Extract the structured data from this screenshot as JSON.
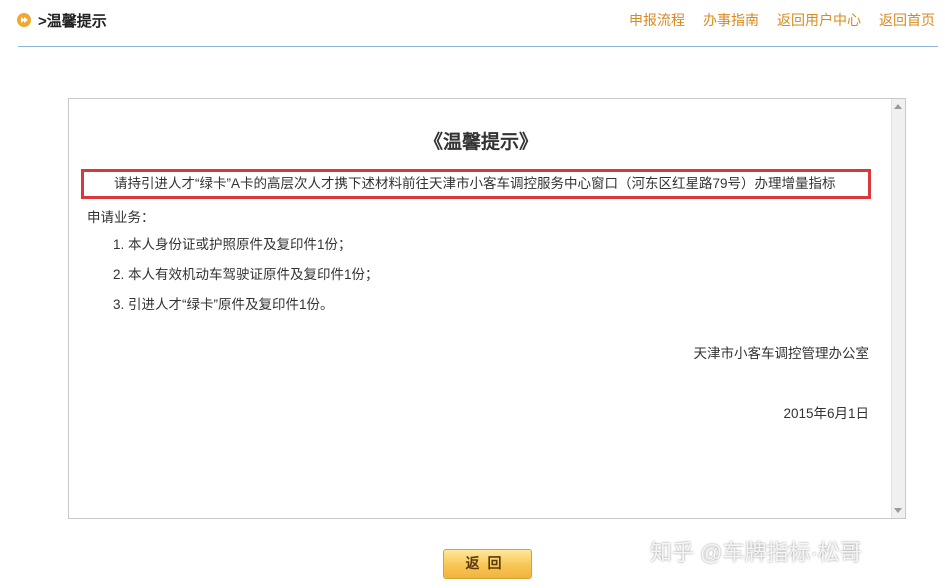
{
  "header": {
    "title": ">温馨提示",
    "nav": [
      "申报流程",
      "办事指南",
      "返回用户中心",
      "返回首页"
    ]
  },
  "notice": {
    "title": "《温馨提示》",
    "para1": "请持引进人才“绿卡”A卡的高层次人才携下述材料前往天津市小客车调控服务中心窗口（河东区红星路79号）办理增量指标",
    "para2": "申请业务：",
    "items": [
      "1. 本人身份证或护照原件及复印件1份；",
      "2. 本人有效机动车驾驶证原件及复印件1份；",
      "3. 引进人才“绿卡”原件及复印件1份。"
    ],
    "signature": "天津市小客车调控管理办公室",
    "date": "2015年6月1日"
  },
  "back_button": "返回",
  "watermark": "知乎 @车牌指标·松哥",
  "colors": {
    "nav_link": "#d98a1f",
    "highlight_border": "#d9383d",
    "divider": "#8fb7d9",
    "button": "#f7c655"
  }
}
